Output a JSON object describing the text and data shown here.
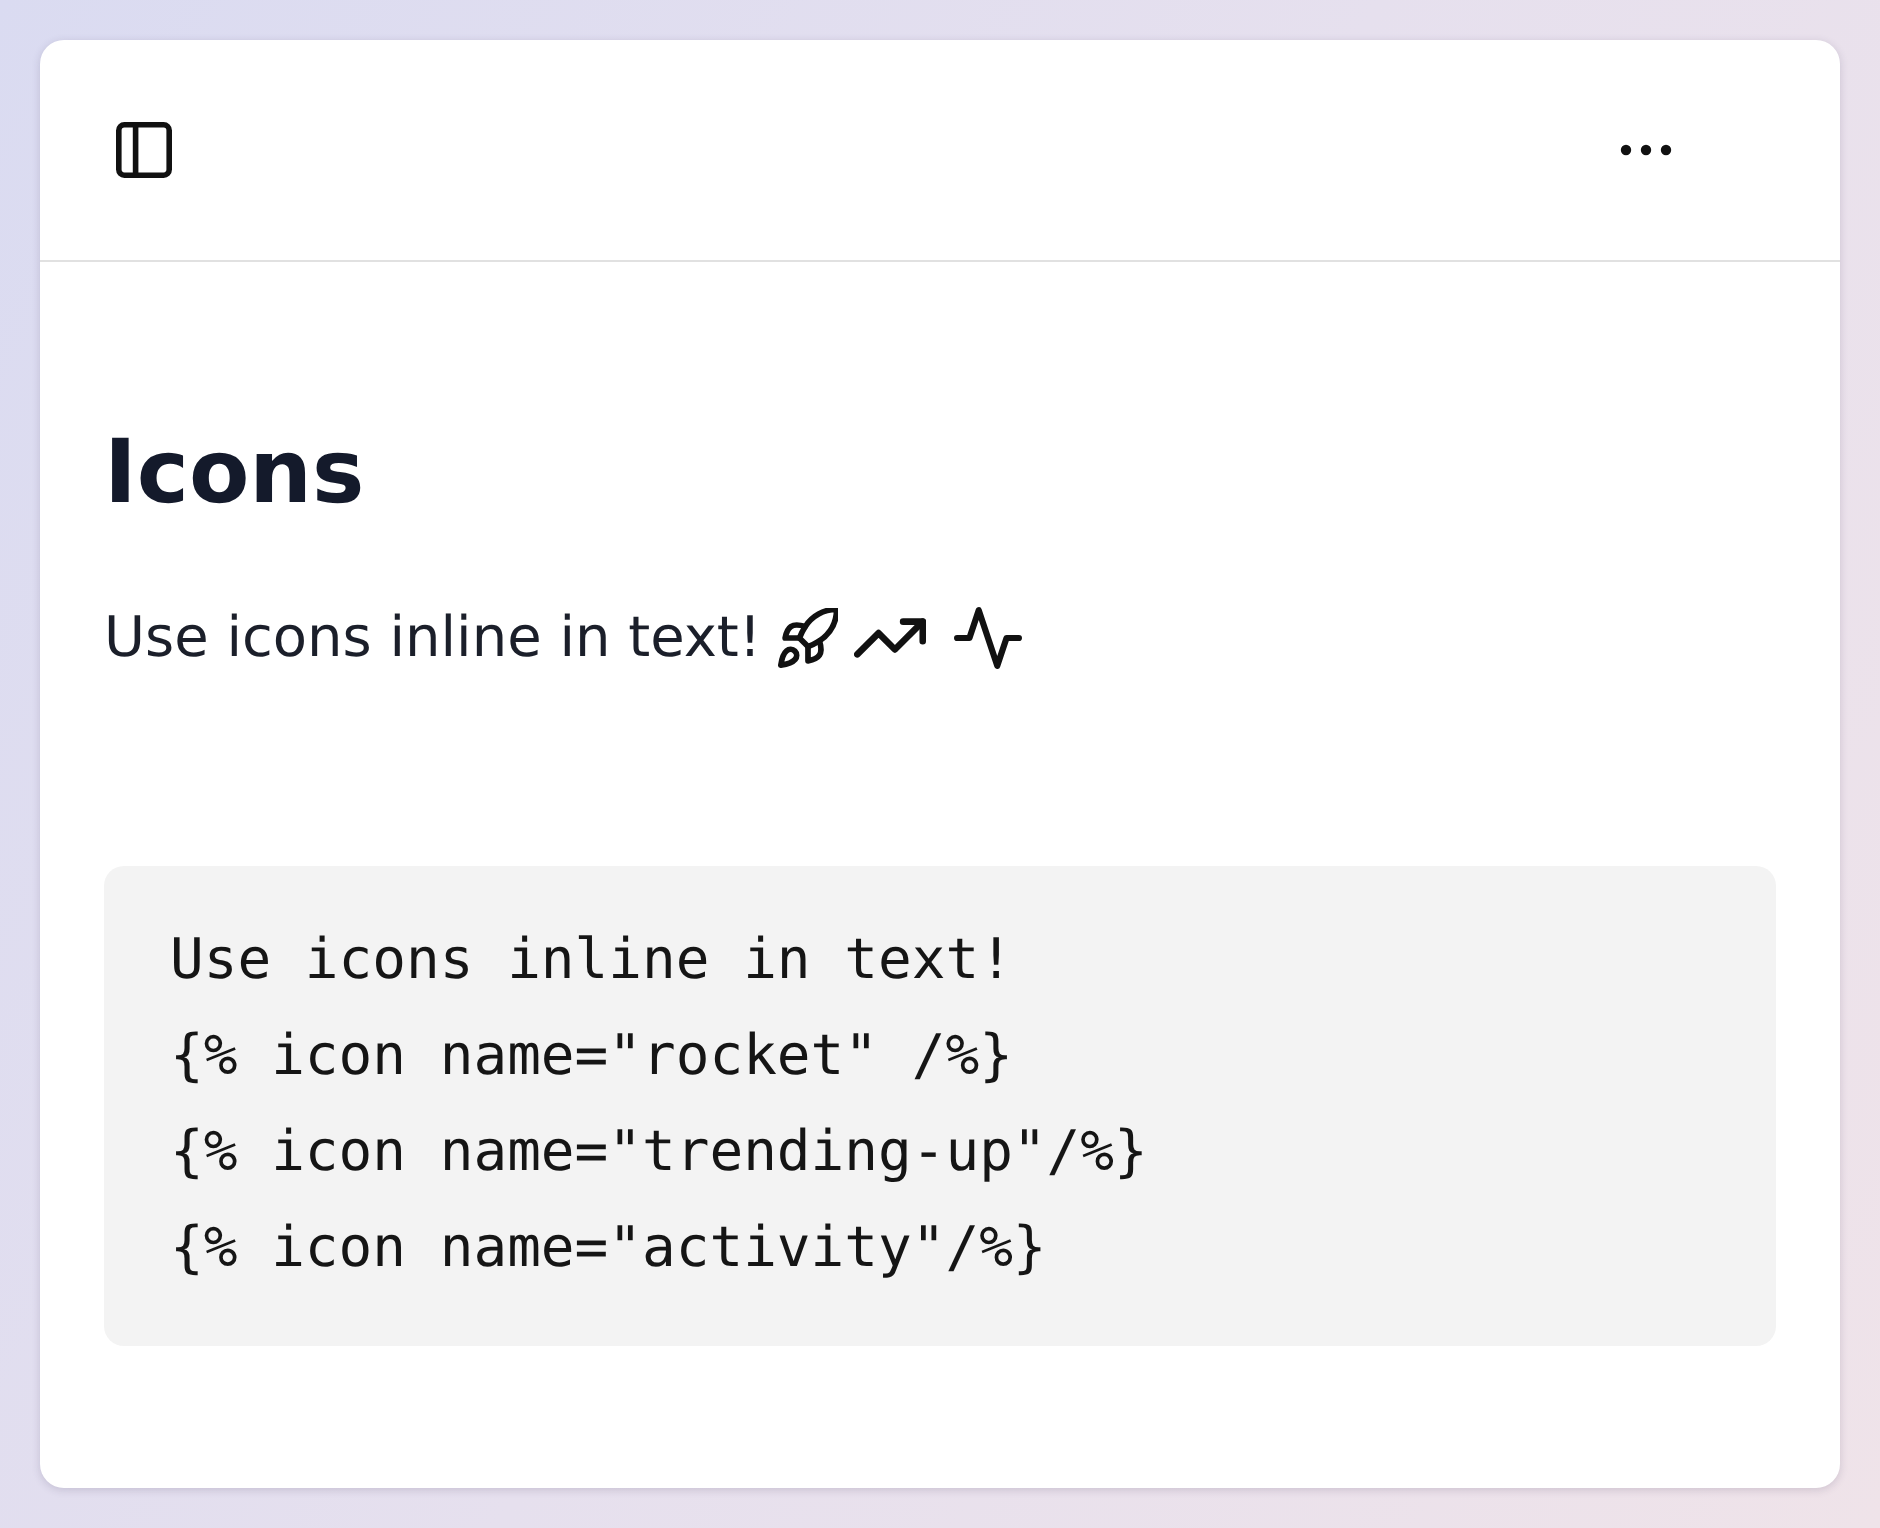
{
  "page": {
    "title": "Icons",
    "paragraph": "Use icons inline in text!"
  },
  "code_block": {
    "lines": [
      "Use icons inline in text!",
      "{% icon name=\"rocket\" /%}",
      "{% icon name=\"trending-up\"/%}",
      "{% icon name=\"activity\"/%}"
    ]
  }
}
